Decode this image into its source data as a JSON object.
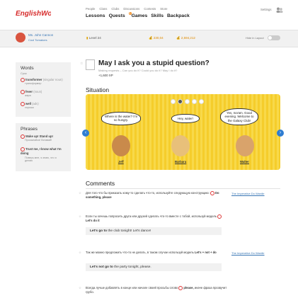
{
  "header": {
    "logo": "EnglishWorld",
    "top_links": [
      "People",
      "Clans",
      "Clubs",
      "Discussions",
      "Contests",
      "Store"
    ],
    "nav": [
      "Lessons",
      "Quests",
      "Games",
      "Skills",
      "Backpack"
    ],
    "quests_badge": "1",
    "settings": "Settings"
  },
  "user": {
    "name": "Ms. John Cannon",
    "status": "Cool Tomatoes",
    "level": "Level 24",
    "coins": "230,04",
    "gems": "2,594,212",
    "hide_label": "Hide in Layout"
  },
  "sidebar": {
    "words_title": "Words",
    "words_sub": "Срок",
    "words": [
      {
        "word": "transformer",
        "tag": "(singular noun)",
        "tr": "трансформер"
      },
      {
        "word": "fever",
        "tag": "(noun)",
        "tr": "жара"
      },
      {
        "word": "well",
        "tag": "(adv)",
        "tr": "хорошо"
      }
    ],
    "phrases_title": "Phrases",
    "phrases": [
      {
        "phrase": "Wake up! Stand up!",
        "tr": "Просыпайся! Вставай!"
      },
      {
        "phrase": "Trust me, I know what I'm doing",
        "tr": "Поверь мне, я знаю, что я делаю"
      }
    ]
  },
  "lesson": {
    "title": "May I ask you a stupid question?",
    "subtitle": "Making requests – Can you do it? Could you do it? May I do it?",
    "xp": "+1,600 XP",
    "situation_title": "Situation",
    "characters": [
      {
        "name": "Jeff",
        "line": "Where is the water? I'm so hungry.",
        "color": "#c98a4b"
      },
      {
        "name": "Barbara",
        "line": "Hey, water!",
        "color": "#e8c07a"
      },
      {
        "name": "Walter",
        "line": "Yes, ma'am. Good evening. Welcome to the Galaxy Club!",
        "color": "#d9a36b"
      }
    ]
  },
  "comments": {
    "title": "Comments",
    "items": [
      {
        "text": "Для того что бы приказать кому-то сделать что-то, используйте следующую конструкцию:",
        "strong": "Do something, please",
        "link": "The Imperative Do Wardle"
      },
      {
        "text": "Если ты хочешь попросить друга или друзей сделать что-то вместе с тобой, используй модель",
        "strong": "Let's do it",
        "example_bold": "Let's go to",
        "example_rest": " the club tonight! Let's dance!"
      },
      {
        "text": "Так же можно предложить что-то не делать, в таком случае используй модель",
        "strong": "Let's + not + do",
        "link": "The Imperative Do Wardle",
        "example_bold": "Let's not go to",
        "example_rest": " the party tonight, please."
      },
      {
        "text": "Всегда лучше добавлять в конце или начале своей просьбы слово",
        "strong": "please,",
        "text2": "иначе фраза прозвучит грубо."
      }
    ]
  }
}
